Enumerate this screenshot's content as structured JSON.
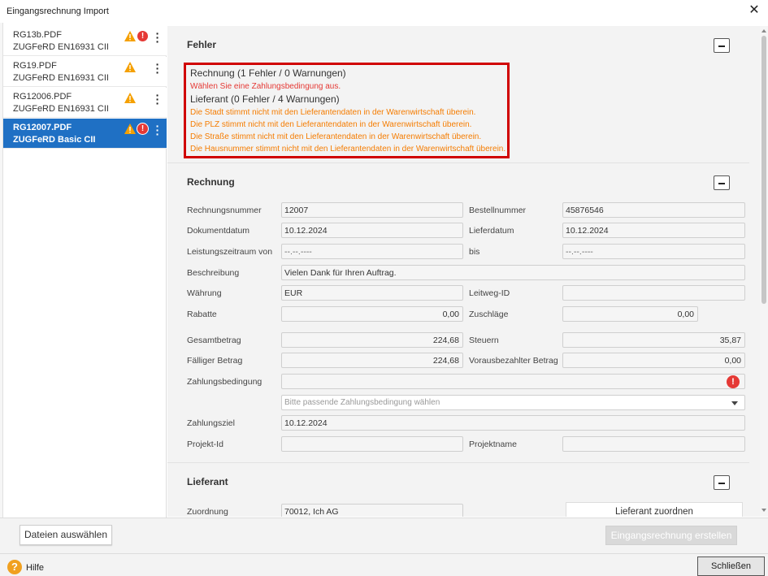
{
  "window": {
    "title": "Eingangsrechnung Import",
    "close_glyph": "✕"
  },
  "files": [
    {
      "name": "RG13b.PDF",
      "type": "ZUGFeRD EN16931 CII",
      "warning": true,
      "error": true,
      "selected": false
    },
    {
      "name": "RG19.PDF",
      "type": "ZUGFeRD EN16931 CII",
      "warning": true,
      "error": false,
      "selected": false
    },
    {
      "name": "RG12006.PDF",
      "type": "ZUGFeRD EN16931 CII",
      "warning": true,
      "error": false,
      "selected": false
    },
    {
      "name": "RG12007.PDF",
      "type": "ZUGFeRD Basic CII",
      "warning": true,
      "error": true,
      "selected": true
    }
  ],
  "errors_section": {
    "title": "Fehler",
    "rechnung_header": "Rechnung (1 Fehler / 0 Warnungen)",
    "rechnung_errors": [
      "Wählen Sie eine Zahlungsbedingung aus."
    ],
    "lieferant_header": "Lieferant (0 Fehler / 4 Warnungen)",
    "lieferant_warnings": [
      "Die Stadt stimmt nicht mit den Lieferantendaten in der Warenwirtschaft überein.",
      "Die PLZ stimmt nicht mit den Lieferantendaten in der Warenwirtschaft überein.",
      "Die Straße stimmt nicht mit den Lieferantendaten in der Warenwirtschaft überein.",
      "Die Hausnummer stimmt nicht mit den Lieferantendaten in der Warenwirtschaft überein."
    ]
  },
  "rechnung": {
    "title": "Rechnung",
    "labels": {
      "rechnungsnummer": "Rechnungsnummer",
      "bestellnummer": "Bestellnummer",
      "dokumentdatum": "Dokumentdatum",
      "lieferdatum": "Lieferdatum",
      "leistungszeitraum_von": "Leistungszeitraum von",
      "bis": "bis",
      "beschreibung": "Beschreibung",
      "waehrung": "Währung",
      "leitweg_id": "Leitweg-ID",
      "rabatte": "Rabatte",
      "zuschlaege": "Zuschläge",
      "gesamtbetrag": "Gesamtbetrag",
      "steuern": "Steuern",
      "faelliger_betrag": "Fälliger Betrag",
      "vorausbezahlter_betrag": "Vorausbezahlter Betrag",
      "zahlungsbedingung": "Zahlungsbedingung",
      "zahlungsziel": "Zahlungsziel",
      "projekt_id": "Projekt-Id",
      "projektname": "Projektname"
    },
    "values": {
      "rechnungsnummer": "12007",
      "bestellnummer": "45876546",
      "dokumentdatum": "10.12.2024",
      "lieferdatum": "10.12.2024",
      "leistungszeitraum_von": "--.--.----",
      "bis": "--.--.----",
      "beschreibung": "Vielen Dank für Ihren Auftrag.",
      "waehrung": "EUR",
      "leitweg_id": "",
      "rabatte": "0,00",
      "zuschlaege": "0,00",
      "gesamtbetrag": "224,68",
      "steuern": "35,87",
      "faelliger_betrag": "224,68",
      "vorausbezahlter_betrag": "0,00",
      "zahlungsbedingung": "",
      "zahlungsziel": "10.12.2024",
      "projekt_id": "",
      "projektname": ""
    },
    "zahlungsbedingung_placeholder": "Bitte passende Zahlungsbedingung wählen"
  },
  "lieferant": {
    "title": "Lieferant",
    "zuordnung_label": "Zuordnung",
    "zuordnung_value": "70012, Ich AG",
    "assign_button": "Lieferant zuordnen"
  },
  "footer": {
    "select_files": "Dateien auswählen",
    "create": "Eingangsrechnung erstellen",
    "help": "Hilfe",
    "close": "Schließen"
  },
  "colors": {
    "accent": "#1f70c4",
    "error": "#e53935",
    "warning": "#f57c00",
    "highlight_border": "#d00000"
  },
  "icons": {
    "warning": "warning-triangle-icon",
    "error": "error-circle-icon",
    "more": "kebab-menu-icon",
    "help": "help-icon"
  }
}
